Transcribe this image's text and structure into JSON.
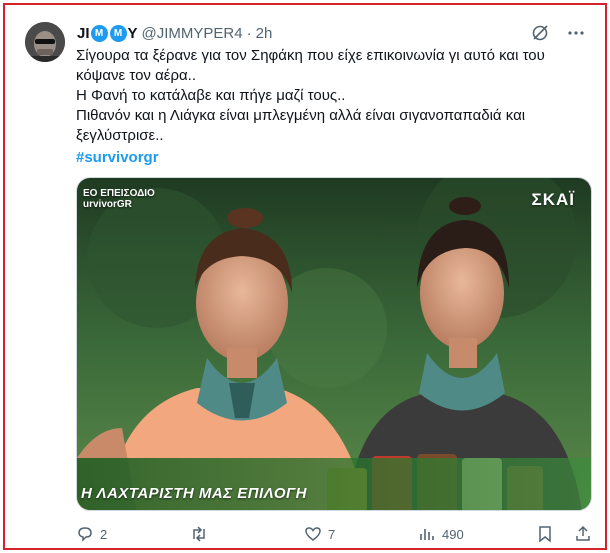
{
  "user": {
    "display_name_start": "JI",
    "display_name_badge_1": "M",
    "display_name_badge_2": "M",
    "display_name_end": "Y",
    "handle": "@JIMMYPER4",
    "separator": "·",
    "time": "2h"
  },
  "tweet": {
    "lines": [
      "Σίγουρα τα ξέρανε για τον Σηφάκη που είχε επικοινωνία γι αυτό και του κόψανε τον αέρα..",
      "Η Φανή το κατάλαβε και πήγε μαζί τους..",
      "Πιθανόν και η Λιάγκα είναι μπλεγμένη αλλά είναι σιγανοπαπαδιά και ξεγλύστρισε.."
    ],
    "hashtag": "#survivorgr"
  },
  "media": {
    "overlay_top_left_1": "ΕΟ ΕΠΕΙΣΟΔΙΟ",
    "overlay_top_left_2": "urvivorGR",
    "logo": "ΣΚΑΪ",
    "banner_text": "Η ΛΑΧΤΑΡΙΣΤΗ ΜΑΣ ΕΠΙΛΟΓΗ"
  },
  "actions": {
    "replies": "2",
    "reposts": "",
    "likes": "7",
    "views": "490"
  },
  "icons": {
    "grok": "grok-icon",
    "more": "more-icon",
    "reply": "reply-icon",
    "repost": "repost-icon",
    "like": "like-icon",
    "views": "views-icon",
    "bookmark": "bookmark-icon",
    "share": "share-icon"
  },
  "colors": {
    "accent": "#1d9bf0",
    "muted": "#536471",
    "frame_border": "#d4232b"
  }
}
